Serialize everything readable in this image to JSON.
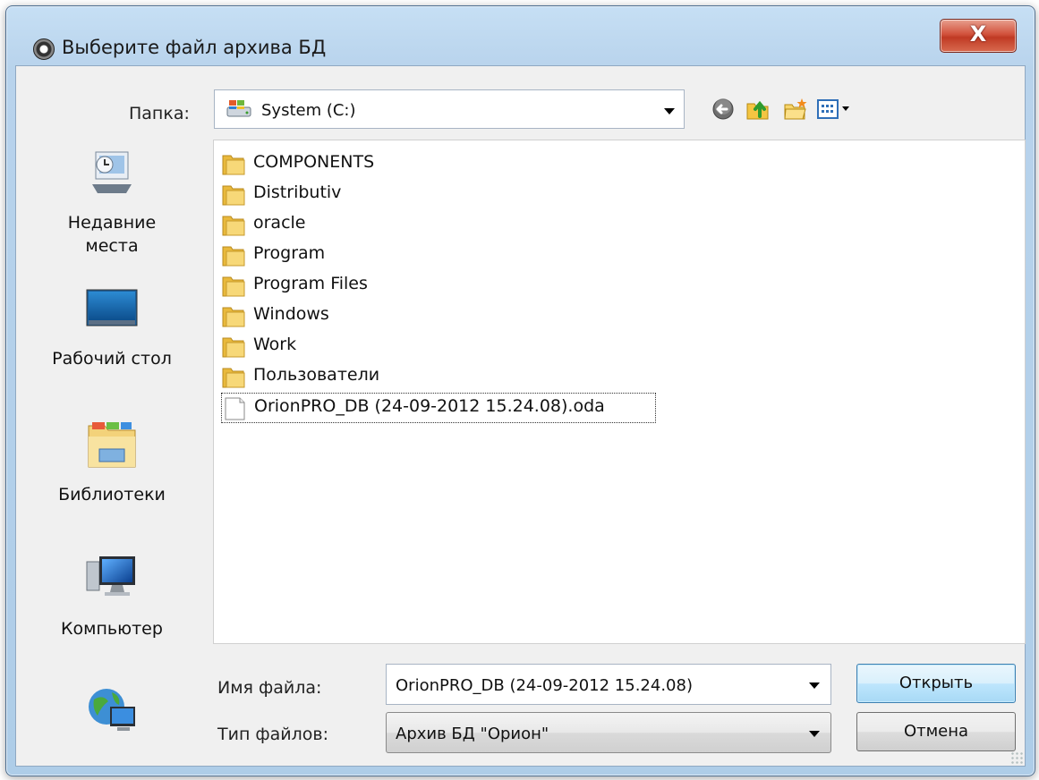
{
  "window": {
    "title": "Выберите файл архива БД",
    "close_label": "X"
  },
  "toolbar": {
    "folder_label": "Папка:",
    "folder_value": "System (C:)",
    "buttons": [
      "back-icon",
      "up-folder-icon",
      "new-folder-icon",
      "view-menu-icon"
    ]
  },
  "places": [
    {
      "label_line1": "Недавние",
      "label_line2": "места",
      "icon": "recent-places-icon"
    },
    {
      "label_line1": "Рабочий стол",
      "label_line2": "",
      "icon": "desktop-icon"
    },
    {
      "label_line1": "Библиотеки",
      "label_line2": "",
      "icon": "libraries-icon"
    },
    {
      "label_line1": "Компьютер",
      "label_line2": "",
      "icon": "computer-icon"
    },
    {
      "label_line1": "",
      "label_line2": "",
      "icon": "network-icon"
    }
  ],
  "files": [
    {
      "name": "COMPONENTS",
      "type": "folder"
    },
    {
      "name": "Distributiv",
      "type": "folder"
    },
    {
      "name": "oracle",
      "type": "folder"
    },
    {
      "name": "Program",
      "type": "folder"
    },
    {
      "name": "Program Files",
      "type": "folder"
    },
    {
      "name": "Windows",
      "type": "folder"
    },
    {
      "name": "Work",
      "type": "folder"
    },
    {
      "name": "Пользователи",
      "type": "folder"
    },
    {
      "name": "OrionPRO_DB (24-09-2012 15.24.08).oda",
      "type": "file",
      "selected": true
    }
  ],
  "bottom": {
    "filename_label": "Имя файла:",
    "filename_value": "OrionPRO_DB (24-09-2012 15.24.08)",
    "filetype_label": "Тип файлов:",
    "filetype_value": "Архив БД \"Орион\"",
    "open_label": "Открыть",
    "cancel_label": "Отмена"
  }
}
